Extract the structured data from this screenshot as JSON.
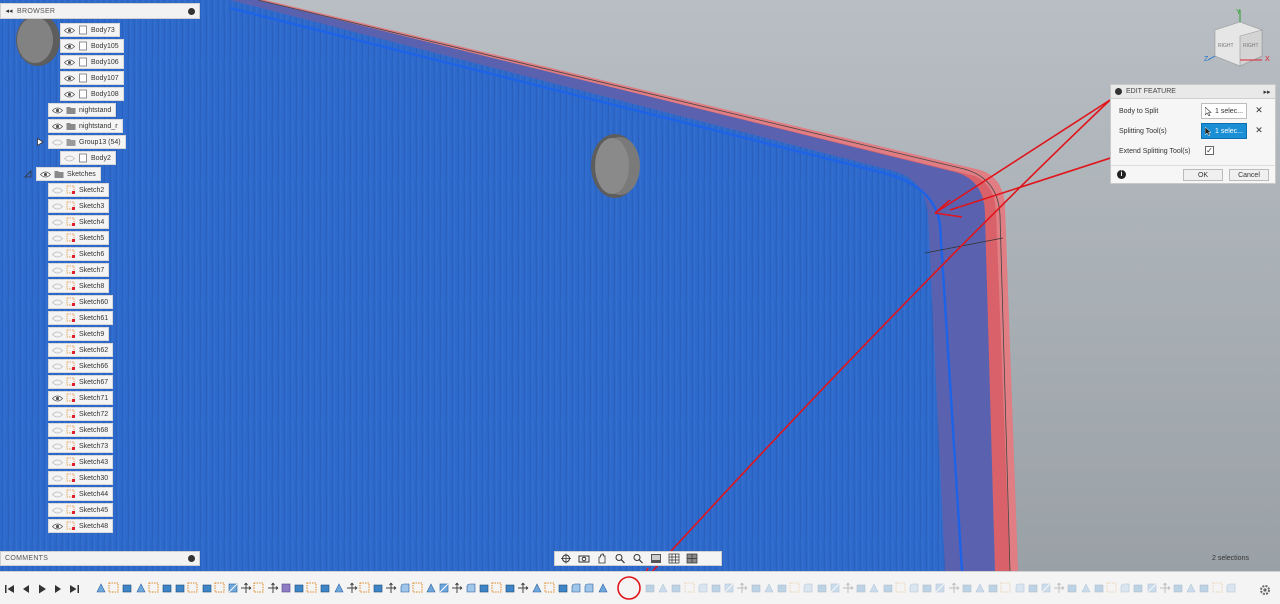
{
  "browser": {
    "title": "BROWSER",
    "collapse_icon": "double-chevron-left-icon",
    "items": [
      {
        "label": "Body73",
        "type": "body",
        "visible": true
      },
      {
        "label": "Body105",
        "type": "body",
        "visible": true
      },
      {
        "label": "Body106",
        "type": "body",
        "visible": true
      },
      {
        "label": "Body107",
        "type": "body",
        "visible": true
      },
      {
        "label": "Body108",
        "type": "body",
        "visible": true
      },
      {
        "label": "nightstand",
        "type": "component",
        "visible": true
      },
      {
        "label": "nightstand_r",
        "type": "component",
        "visible": true
      },
      {
        "label": "Group13 (54)",
        "type": "group",
        "visible": false
      },
      {
        "label": "Body2",
        "type": "body",
        "visible": false
      },
      {
        "label": "Sketches",
        "type": "folder",
        "visible": true
      },
      {
        "label": "Sketch2",
        "type": "sketch",
        "visible": false
      },
      {
        "label": "Sketch3",
        "type": "sketch",
        "visible": false
      },
      {
        "label": "Sketch4",
        "type": "sketch",
        "visible": false
      },
      {
        "label": "Sketch5",
        "type": "sketch",
        "visible": false
      },
      {
        "label": "Sketch6",
        "type": "sketch",
        "visible": false
      },
      {
        "label": "Sketch7",
        "type": "sketch",
        "visible": false
      },
      {
        "label": "Sketch8",
        "type": "sketch",
        "visible": false
      },
      {
        "label": "Sketch60",
        "type": "sketch",
        "visible": false
      },
      {
        "label": "Sketch61",
        "type": "sketch",
        "visible": false
      },
      {
        "label": "Sketch9",
        "type": "sketch",
        "visible": false
      },
      {
        "label": "Sketch62",
        "type": "sketch",
        "visible": false
      },
      {
        "label": "Sketch66",
        "type": "sketch",
        "visible": false
      },
      {
        "label": "Sketch67",
        "type": "sketch",
        "visible": false
      },
      {
        "label": "Sketch71",
        "type": "sketch",
        "visible": true
      },
      {
        "label": "Sketch72",
        "type": "sketch",
        "visible": false
      },
      {
        "label": "Sketch68",
        "type": "sketch",
        "visible": false
      },
      {
        "label": "Sketch73",
        "type": "sketch",
        "visible": false
      },
      {
        "label": "Sketch43",
        "type": "sketch",
        "visible": false
      },
      {
        "label": "Sketch30",
        "type": "sketch",
        "visible": false
      },
      {
        "label": "Sketch44",
        "type": "sketch",
        "visible": false
      },
      {
        "label": "Sketch45",
        "type": "sketch",
        "visible": false
      },
      {
        "label": "Sketch48",
        "type": "sketch",
        "visible": true
      }
    ]
  },
  "edit_feature": {
    "title": "EDIT FEATURE",
    "body_to_split_label": "Body to Split",
    "body_to_split_value": "1 selec...",
    "splitting_tools_label": "Splitting Tool(s)",
    "splitting_tools_value": "1 selec...",
    "extend_label": "Extend Splitting Tool(s)",
    "extend_checked": true,
    "ok_label": "OK",
    "cancel_label": "Cancel",
    "info_icon": "info-icon"
  },
  "comments": {
    "title": "COMMENTS"
  },
  "status": {
    "selections": "2 selections"
  },
  "viewcube": {
    "face_top": "RIGHT",
    "face_side": "RIGHT",
    "axis_y": "Y",
    "axis_x": "X",
    "axis_z": "Z"
  },
  "colors": {
    "board_blue": "#2f6fd0",
    "edge_red": "#d9626a",
    "annotation_red": "#e0141b",
    "accent": "#1b8fd6"
  }
}
